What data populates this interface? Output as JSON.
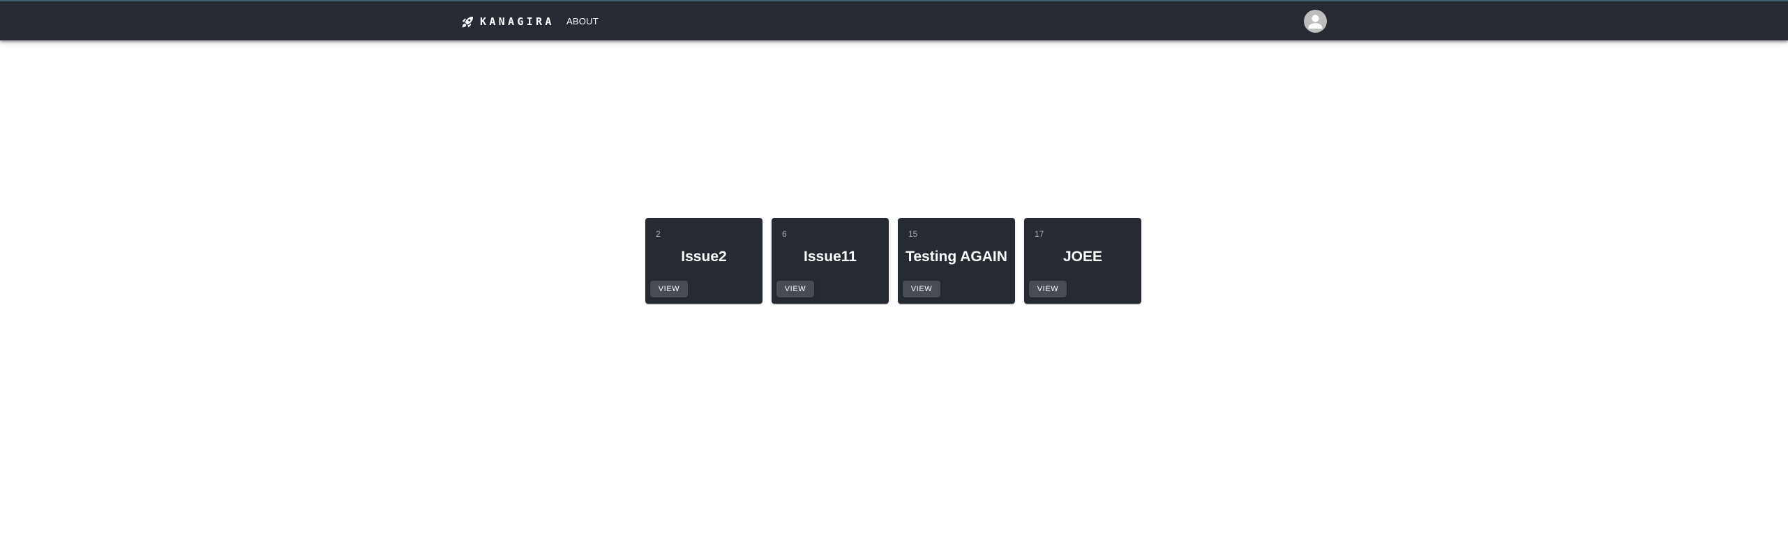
{
  "header": {
    "brand_icon": "rocket-icon",
    "brand_name": "KANAGIRA",
    "nav_about": "ABOUT",
    "avatar_icon": "person-icon",
    "colors": {
      "appbar": "#262b33",
      "appbar_top_border": "#3e5f6b",
      "avatar_bg": "#bdbdbd"
    }
  },
  "issues": [
    {
      "id": "2",
      "title": "Issue2",
      "view_label": "VIEW"
    },
    {
      "id": "6",
      "title": "Issue11",
      "view_label": "VIEW"
    },
    {
      "id": "15",
      "title": "Testing AGAIN",
      "view_label": "VIEW"
    },
    {
      "id": "17",
      "title": "JOEE",
      "view_label": "VIEW"
    }
  ],
  "colors": {
    "card_bg": "#262b33",
    "button_bg": "#474c55",
    "page_bg": "#ffffff"
  }
}
